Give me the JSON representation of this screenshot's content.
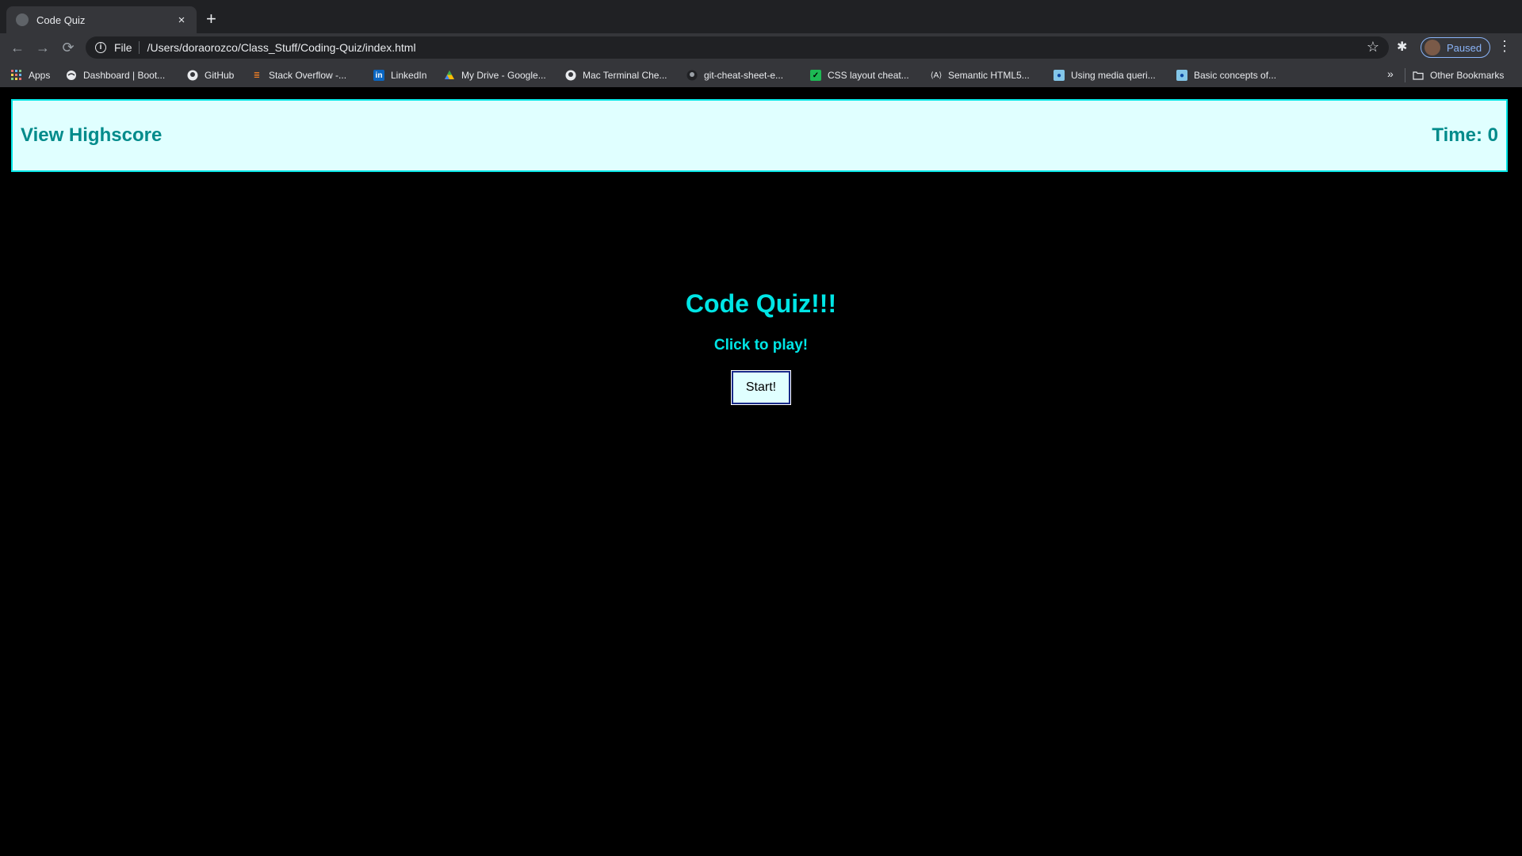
{
  "browser": {
    "tab": {
      "title": "Code Quiz",
      "close": "×"
    },
    "new_tab": "+",
    "nav": {
      "back": "←",
      "forward": "→",
      "reload": "⟳"
    },
    "address": {
      "scheme_label": "File",
      "url": "/Users/doraorozco/Class_Stuff/Coding-Quiz/index.html"
    },
    "profile": {
      "label": "Paused"
    },
    "bookmarks": [
      {
        "label": "Apps",
        "icon": "apps-grid-icon"
      },
      {
        "label": "Dashboard | Boot...",
        "icon": "globe-icon"
      },
      {
        "label": "GitHub",
        "icon": "github-icon"
      },
      {
        "label": "Stack Overflow -...",
        "icon": "stackoverflow-icon"
      },
      {
        "label": "LinkedIn",
        "icon": "linkedin-icon"
      },
      {
        "label": "My Drive - Google...",
        "icon": "google-drive-icon"
      },
      {
        "label": "Mac Terminal Che...",
        "icon": "github-icon"
      },
      {
        "label": "git-cheat-sheet-e...",
        "icon": "github-icon"
      },
      {
        "label": "CSS layout cheat...",
        "icon": "css-icon"
      },
      {
        "label": "Semantic HTML5...",
        "icon": "semantic-icon"
      },
      {
        "label": "Using media queri...",
        "icon": "mdn-icon"
      },
      {
        "label": "Basic concepts of...",
        "icon": "mdn-icon"
      }
    ],
    "more_bookmarks": "»",
    "other_bookmarks": "Other Bookmarks"
  },
  "page": {
    "header": {
      "highscore_link": "View Highscore",
      "time_label": "Time: 0"
    },
    "title": "Code Quiz!!!",
    "subtitle": "Click to play!",
    "start_button": "Start!"
  },
  "colors": {
    "accent": "#00e5e5",
    "header_bg": "#e0ffff",
    "header_text": "#008b8b",
    "page_bg": "#000000"
  }
}
